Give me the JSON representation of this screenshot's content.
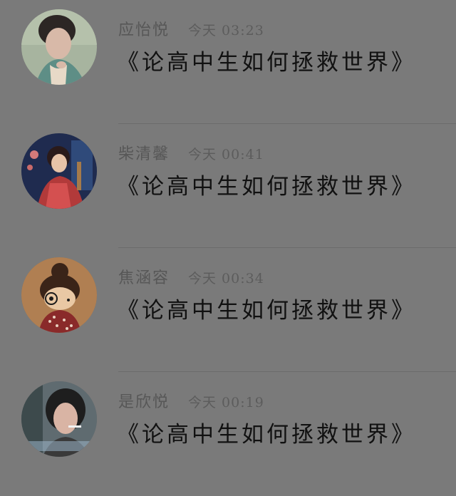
{
  "colors": {
    "background": "#7a7a7a",
    "title_text": "#111111",
    "meta_text": "#575757"
  },
  "messages": [
    {
      "sender": "应怡悦",
      "time": "今天 03:23",
      "title": "《论高中生如何拯救世界》",
      "avatar_icon": "avatar-girl-green-hanfu"
    },
    {
      "sender": "柴清馨",
      "time": "今天 00:41",
      "title": "《论高中生如何拯救世界》",
      "avatar_icon": "avatar-anime-girl-red-dress"
    },
    {
      "sender": "焦涵容",
      "time": "今天 00:34",
      "title": "《论高中生如何拯救世界》",
      "avatar_icon": "avatar-cartoon-doll-bun"
    },
    {
      "sender": "是欣悦",
      "time": "今天 00:19",
      "title": "《论高中生如何拯救世界》",
      "avatar_icon": "avatar-girl-cigarette"
    }
  ]
}
